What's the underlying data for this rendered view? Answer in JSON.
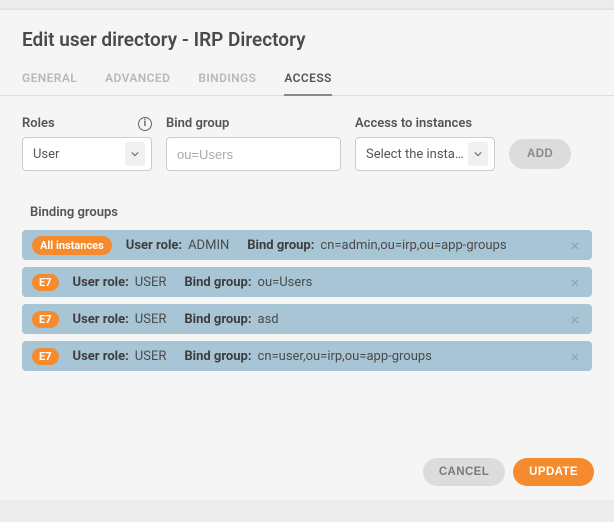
{
  "title": "Edit user directory - IRP Directory",
  "tabs": [
    "GENERAL",
    "ADVANCED",
    "BINDINGS",
    "ACCESS"
  ],
  "active_tab": 3,
  "form": {
    "roles_label": "Roles",
    "roles_value": "User",
    "bind_label": "Bind group",
    "bind_placeholder": "ou=Users",
    "instances_label": "Access to instances",
    "instances_value": "Select the insta…",
    "add_label": "ADD"
  },
  "section_title": "Binding groups",
  "labels": {
    "user_role": "User role:",
    "bind_group": "Bind group:"
  },
  "rows": [
    {
      "badge": "All instances",
      "role": "ADMIN",
      "bind": "cn=admin,ou=irp,ou=app-groups"
    },
    {
      "badge": "E7",
      "role": "USER",
      "bind": "ou=Users"
    },
    {
      "badge": "E7",
      "role": "USER",
      "bind": "asd"
    },
    {
      "badge": "E7",
      "role": "USER",
      "bind": "cn=user,ou=irp,ou=app-groups"
    }
  ],
  "buttons": {
    "cancel": "CANCEL",
    "update": "UPDATE"
  }
}
